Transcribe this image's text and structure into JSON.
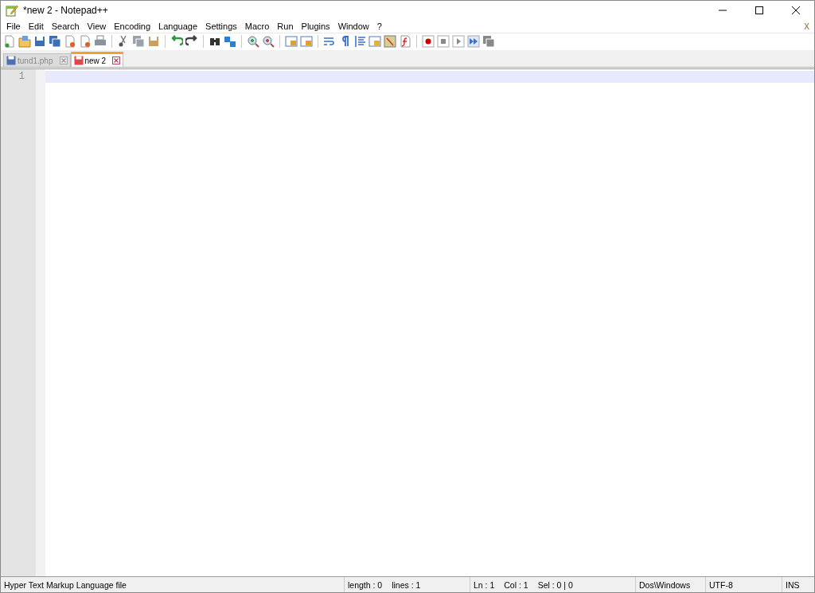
{
  "window": {
    "title": "*new 2 - Notepad++"
  },
  "menu": [
    "File",
    "Edit",
    "Search",
    "View",
    "Encoding",
    "Language",
    "Settings",
    "Macro",
    "Run",
    "Plugins",
    "Window",
    "?"
  ],
  "menu_close": "X",
  "tabs": [
    {
      "label": "tund1.php",
      "selected": false,
      "modified": false
    },
    {
      "label": "new 2",
      "selected": true,
      "modified": true
    }
  ],
  "editor": {
    "line_numbers": [
      "1"
    ]
  },
  "status_bar": {
    "file_type": "Hyper Text Markup Language file",
    "length": "length : 0",
    "lines": "lines : 1",
    "ln": "Ln : 1",
    "col": "Col : 1",
    "sel": "Sel : 0 | 0",
    "eol": "Dos\\Windows",
    "encoding": "UTF-8",
    "mode": "INS"
  }
}
